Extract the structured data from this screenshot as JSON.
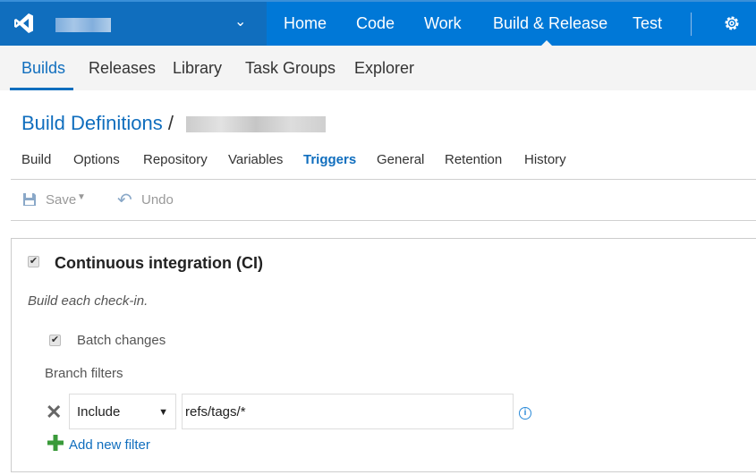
{
  "topbar": {
    "nav": [
      "Home",
      "Code",
      "Work",
      "Build & Release",
      "Test"
    ],
    "active": "Build & Release",
    "accent": "#0078d7"
  },
  "subnav": {
    "items": [
      "Builds",
      "Releases",
      "Library",
      "Task Groups",
      "Explorer"
    ],
    "active": "Builds"
  },
  "breadcrumb": {
    "root": "Build Definitions",
    "separator": "/"
  },
  "tabs": {
    "items": [
      "Build",
      "Options",
      "Repository",
      "Variables",
      "Triggers",
      "General",
      "Retention",
      "History"
    ],
    "active": "Triggers"
  },
  "toolbar": {
    "save": "Save",
    "undo": "Undo"
  },
  "ci": {
    "title": "Continuous integration (CI)",
    "enabled": true,
    "description": "Build each check-in.",
    "batch_label": "Batch changes",
    "batch_checked": true,
    "branch_filters_label": "Branch filters",
    "filter": {
      "type": "Include",
      "value": "refs/tags/*"
    },
    "add_filter": "Add new filter"
  }
}
